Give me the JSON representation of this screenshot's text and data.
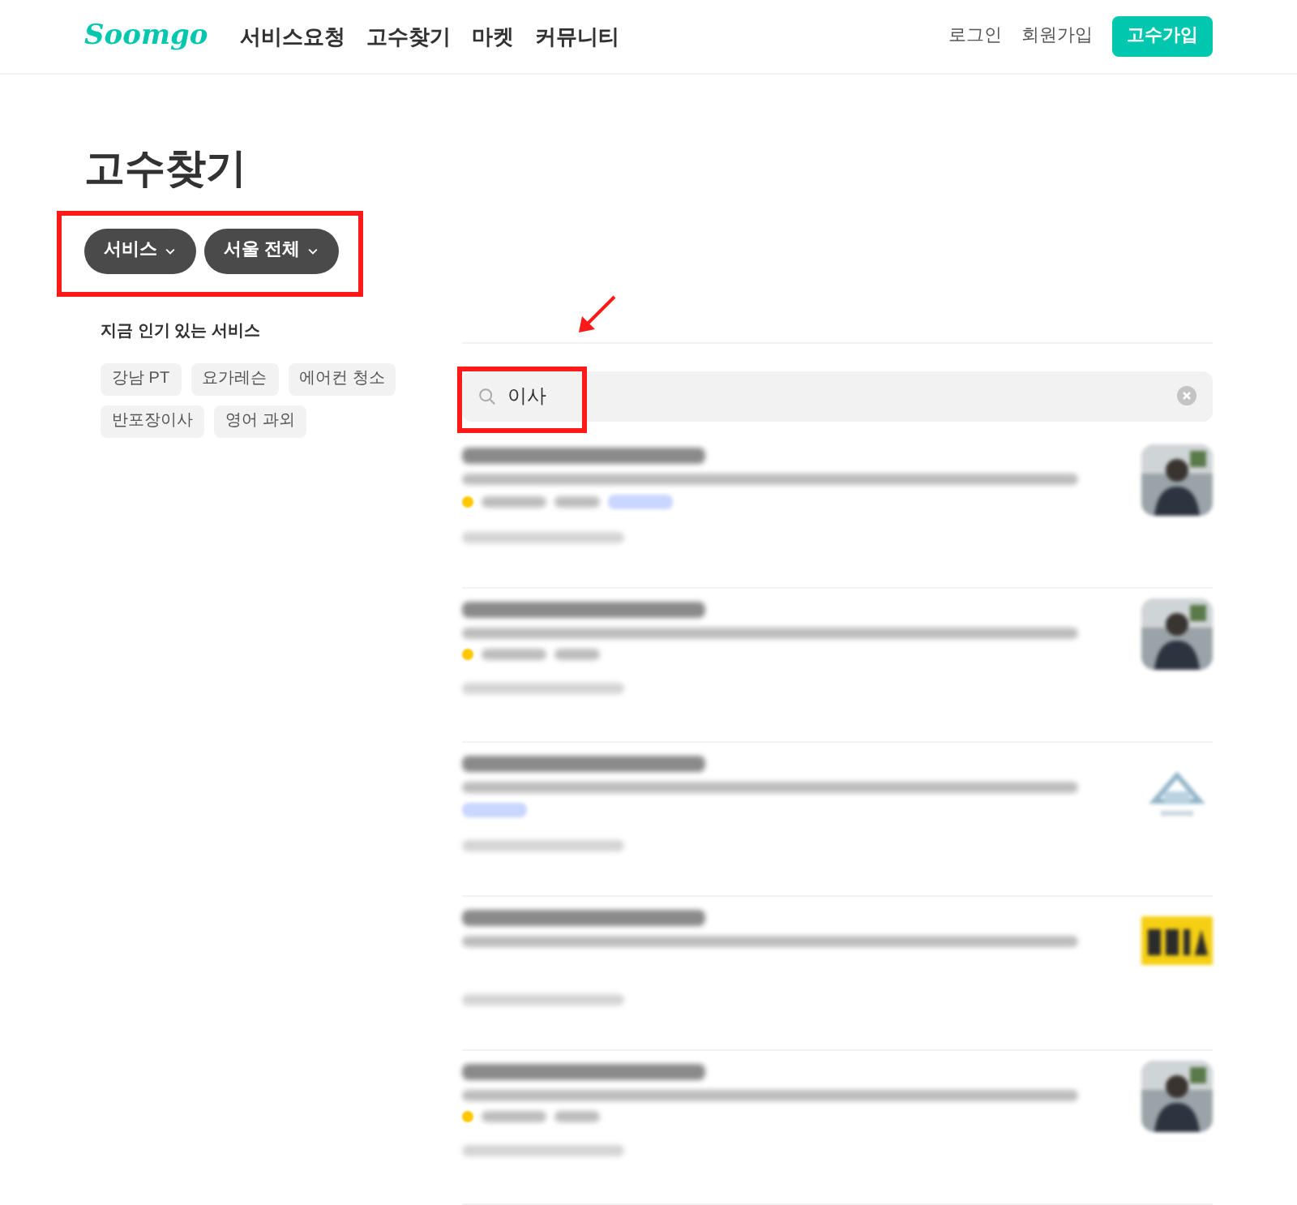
{
  "header": {
    "logo": "Soomgo",
    "nav": [
      "서비스요청",
      "고수찾기",
      "마켓",
      "커뮤니티"
    ],
    "login": "로그인",
    "signup": "회원가입",
    "pro_signup": "고수가입"
  },
  "page_title": "고수찾기",
  "filters": [
    {
      "label": "서비스"
    },
    {
      "label": "서울 전체"
    }
  ],
  "annotations": {
    "filters_frame": true,
    "search_frame": true
  },
  "popular": {
    "heading": "지금 인기 있는 서비스",
    "tags": [
      "강남 PT",
      "요가레슨",
      "에어컨 청소",
      "반포장이사",
      "영어 과외"
    ]
  },
  "search": {
    "value": "이사"
  },
  "results": [
    {
      "rating": true,
      "badge": true
    },
    {
      "rating": true,
      "badge": false
    },
    {
      "rating": false,
      "badge": true
    },
    {
      "rating": false,
      "badge": false
    },
    {
      "rating": true,
      "badge": false
    }
  ]
}
